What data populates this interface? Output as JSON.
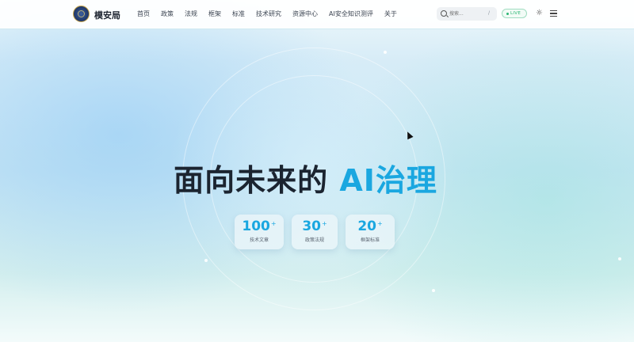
{
  "header": {
    "brand": "模安局",
    "nav": [
      "首页",
      "政策",
      "法规",
      "框架",
      "标准",
      "技术研究",
      "资源中心",
      "AI安全知识测评",
      "关于"
    ],
    "search_placeholder": "搜索...",
    "search_shortcut": "/",
    "live_label": "LIVE"
  },
  "hero": {
    "title_main": "面向未来的 ",
    "title_accent": "AI治理",
    "stats": [
      {
        "value": "100",
        "suffix": "+",
        "label": "技术文章"
      },
      {
        "value": "30",
        "suffix": "+",
        "label": "政策法规"
      },
      {
        "value": "20",
        "suffix": "+",
        "label": "框架标准"
      }
    ]
  },
  "icons": [
    "logo-emblem",
    "search-icon",
    "live-dot-icon",
    "sun-icon",
    "menu-icon",
    "mouse-cursor"
  ],
  "colors": {
    "accent": "#1aa7e0",
    "live": "#2bb673",
    "text": "#1b2430"
  }
}
